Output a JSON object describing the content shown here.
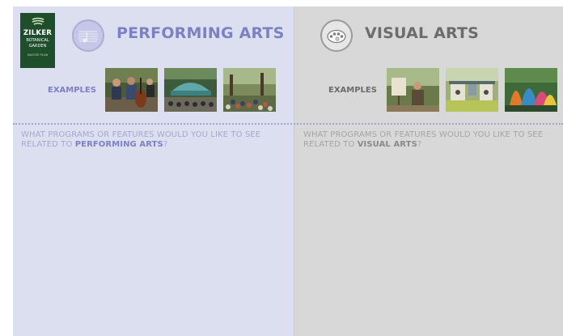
{
  "logo": {
    "name": "ZILKER",
    "sub_line1": "BOTANICAL",
    "sub_line2": "GARDEN",
    "tagline": "MASTER PLAN"
  },
  "performing": {
    "title": "PERFORMING ARTS",
    "examples_label": "EXAMPLES",
    "question_lead": "WHAT PROGRAMS OR FEATURES WOULD YOU LIKE TO SEE RELATED TO ",
    "question_topic": "PERFORMING ARTS",
    "question_tail": "?",
    "photos": [
      "musicians-photo",
      "amphitheater-stage-photo",
      "outdoor-audience-photo"
    ]
  },
  "visual": {
    "title": "VISUAL ARTS",
    "examples_label": "EXAMPLES",
    "question_lead": "WHAT PROGRAMS OR FEATURES WOULD YOU LIKE TO SEE RELATED TO ",
    "question_topic": "VISUAL ARTS",
    "question_tail": "?",
    "photos": [
      "painter-at-easel-photo",
      "garden-art-panels-photo",
      "colorful-sculpture-photo"
    ]
  },
  "colors": {
    "performing_bg": "#dcdff0",
    "visual_bg": "#d8d8d8",
    "performing_accent": "#7c81c4",
    "visual_accent": "#6c6c6c",
    "logo_bg": "#1f4e2c"
  }
}
